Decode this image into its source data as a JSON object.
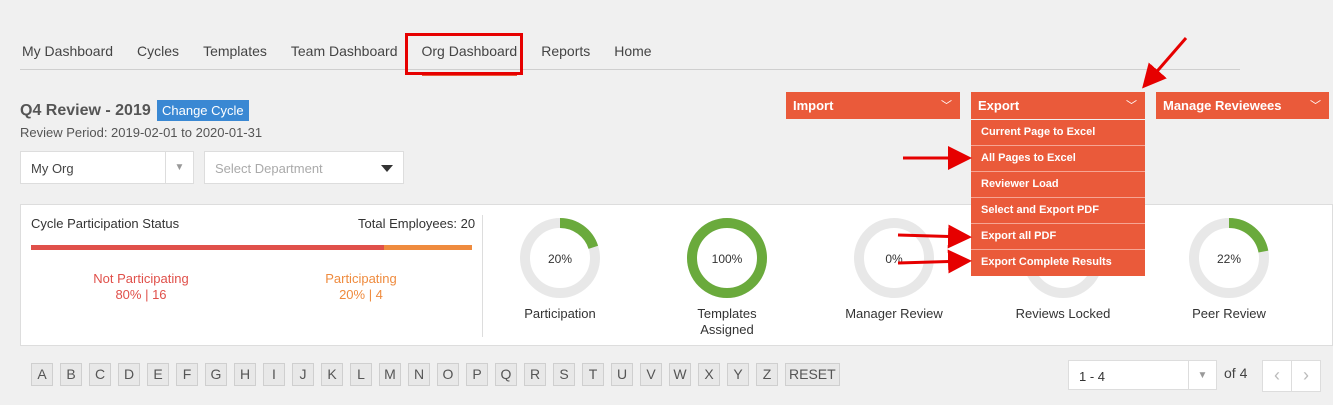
{
  "tabs": [
    {
      "label": "My Dashboard"
    },
    {
      "label": "Cycles"
    },
    {
      "label": "Templates"
    },
    {
      "label": "Team Dashboard"
    },
    {
      "label": "Org Dashboard",
      "active": true
    },
    {
      "label": "Reports"
    },
    {
      "label": "Home"
    }
  ],
  "review": {
    "title": "Q4 Review - 2019",
    "change_cycle_label": "Change Cycle",
    "period": "Review Period: 2019-02-01 to 2020-01-31"
  },
  "filters": {
    "org_value": "My Org",
    "department_placeholder": "Select Department"
  },
  "actions": {
    "import_label": "Import",
    "export_label": "Export",
    "manage_label": "Manage Reviewees",
    "export_menu": [
      "Current Page to Excel",
      "All Pages to Excel",
      "Reviewer Load",
      "Select and Export PDF",
      "Export all PDF",
      "Export Complete Results"
    ]
  },
  "participation": {
    "title": "Cycle Participation Status",
    "total": "Total Employees: 20",
    "not_participating_label": "Not Participating",
    "not_participating_value": "80% | 16",
    "participating_label": "Participating",
    "participating_value": "20% | 4",
    "not_participating_fraction": 0.8
  },
  "rings": [
    {
      "label": "20%",
      "caption": "Participation",
      "fraction": 0.2
    },
    {
      "label": "100%",
      "caption": "Templates Assigned",
      "fraction": 1.0
    },
    {
      "label": "0%",
      "caption": "Manager Review",
      "fraction": 0.0
    },
    {
      "label": "",
      "caption": "Reviews Locked",
      "fraction": 0.0
    },
    {
      "label": "22%",
      "caption": "Peer Review",
      "fraction": 0.22
    }
  ],
  "alphabet": [
    "A",
    "B",
    "C",
    "D",
    "E",
    "F",
    "G",
    "H",
    "I",
    "J",
    "K",
    "L",
    "M",
    "N",
    "O",
    "P",
    "Q",
    "R",
    "S",
    "T",
    "U",
    "V",
    "W",
    "X",
    "Y",
    "Z",
    "RESET"
  ],
  "pager": {
    "range": "1 - 4",
    "of_total": "of 4",
    "prev_icon": "‹",
    "next_icon": "›"
  },
  "colors": {
    "accent": "#ea5a3a",
    "ring_fill": "#6aaa3c",
    "ring_track": "#e8e8e8",
    "annotation": "#e60000"
  }
}
